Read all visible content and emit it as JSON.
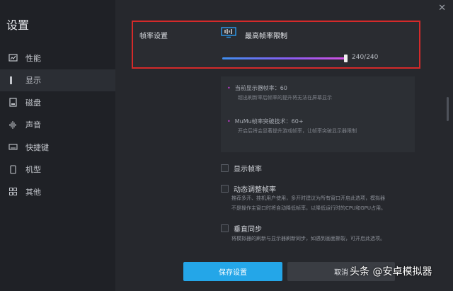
{
  "app": {
    "title": "设置",
    "close_glyph": "✕"
  },
  "sidebar": {
    "items": [
      {
        "label": "性能",
        "icon": "performance-icon"
      },
      {
        "label": "显示",
        "icon": "display-icon",
        "active": true
      },
      {
        "label": "磁盘",
        "icon": "disk-icon"
      },
      {
        "label": "声音",
        "icon": "sound-icon"
      },
      {
        "label": "快捷键",
        "icon": "keyboard-icon"
      },
      {
        "label": "机型",
        "icon": "phone-icon"
      },
      {
        "label": "其他",
        "icon": "grid-icon"
      }
    ]
  },
  "frame_rate": {
    "section_label": "帧率设置",
    "max_label": "最高帧率限制",
    "slider_value": "240/240",
    "slider_fraction": 1.0
  },
  "info": {
    "items": [
      {
        "title": "当前显示器帧率：60",
        "desc": "超出刷新率后帧率的提升将无法在屏幕显示"
      },
      {
        "title": "MuMu帧率突破技术：60+",
        "desc": "开启后将会显著提升游戏帧率，让帧率突破显示器限制"
      }
    ]
  },
  "options": {
    "show_fps": {
      "label": "显示帧率"
    },
    "dynamic_fps": {
      "label": "动态调整帧率",
      "desc_1": "推荐多开、挂机用户使用，多开时建议为所有窗口开启此选项，模拟器",
      "desc_2": "不是操作主窗口时将自动降低帧率，以降低运行时的CPU和GPU占用。"
    },
    "vsync": {
      "label": "垂直同步",
      "desc_1": "将模拟器的刷新与显示器刷新同步，如遇到画面撕裂，可开启此选项。"
    }
  },
  "buttons": {
    "save": "保存设置",
    "cancel": "取消"
  },
  "watermark": "头条 @安卓模拟器",
  "colors": {
    "accent": "#24a6e8",
    "highlight_border": "#d42a2a",
    "bullet": "#c33ad0"
  }
}
